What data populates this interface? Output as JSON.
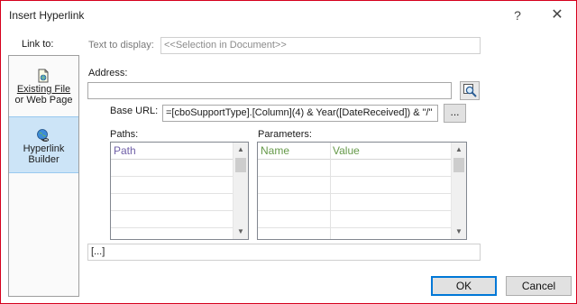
{
  "window": {
    "title": "Insert Hyperlink",
    "help_glyph": "?",
    "close_glyph": "✕"
  },
  "sidebar": {
    "heading": "Link to:",
    "items": [
      {
        "label_line1": "Existing File",
        "label_line2": "or Web Page",
        "icon": "file-icon",
        "active": false
      },
      {
        "label_line1": "Hyperlink",
        "label_line2": "Builder",
        "icon": "globe-link-icon",
        "active": true
      }
    ]
  },
  "text_to_display": {
    "label": "Text to display:",
    "value": "<<Selection in Document>>"
  },
  "address": {
    "label": "Address:",
    "value": ""
  },
  "base_url": {
    "label": "Base URL:",
    "value": "=[cboSupportType].[Column](4) & Year([DateReceived]) & \"/\"",
    "ellipsis": "..."
  },
  "paths": {
    "label": "Paths:",
    "column": "Path"
  },
  "parameters": {
    "label": "Parameters:",
    "columns": [
      "Name",
      "Value"
    ]
  },
  "preview": {
    "value": "[...]"
  },
  "buttons": {
    "ok": "OK",
    "cancel": "Cancel"
  },
  "colors": {
    "border_accent": "#d6001c",
    "active_bg": "#cce4f7",
    "header_green": "#669a4a",
    "header_purple": "#7060a8",
    "default_button_border": "#0078d7"
  }
}
